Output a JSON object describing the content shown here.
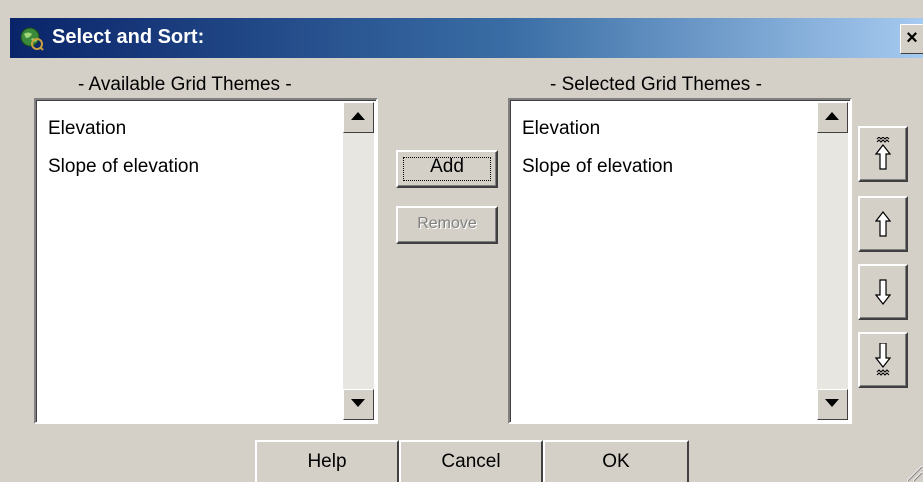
{
  "window": {
    "title": "Select and Sort:",
    "close_label": "×"
  },
  "available": {
    "label": "- Available Grid Themes -",
    "items": [
      "Elevation",
      "Slope of elevation"
    ]
  },
  "selected": {
    "label": "- Selected Grid Themes -",
    "items": [
      "Elevation",
      "Slope of elevation"
    ]
  },
  "actions": {
    "add_label": "Add",
    "remove_label": "Remove"
  },
  "move_buttons": {
    "top_icon": "move-to-top-icon",
    "up_icon": "move-up-icon",
    "down_icon": "move-down-icon",
    "bottom_icon": "move-to-bottom-icon"
  },
  "footer": {
    "help_label": "Help",
    "cancel_label": "Cancel",
    "ok_label": "OK"
  }
}
